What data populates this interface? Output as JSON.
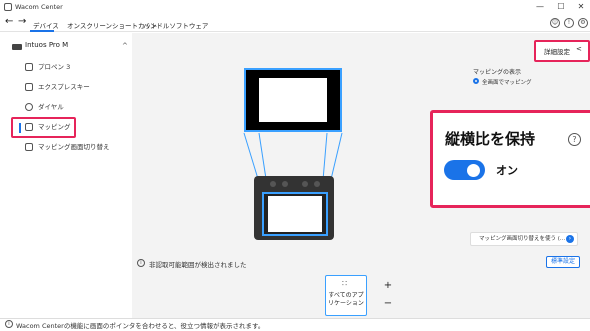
{
  "window": {
    "title": "Wacom Center",
    "minimize": "—",
    "maximize": "☐",
    "close": "✕"
  },
  "nav": {
    "back": "←",
    "forward": "→",
    "tabs": [
      "デバイス",
      "オンスクリーンショートカット",
      "バンドルソフトウェア"
    ]
  },
  "sidebar": {
    "device_name": "Intuos Pro M",
    "items": [
      "プロペン 3",
      "エクスプレスキー",
      "ダイヤル",
      "マッピング",
      "マッピング画面切り替え"
    ],
    "selected": "マッピング"
  },
  "main": {
    "detail_settings": "詳細設定",
    "mapping_display_label": "マッピングの表示",
    "mapping_option": "全画面でマッピング",
    "aspect_title": "縦横比を保持",
    "toggle_label": "オン",
    "toggle_on": true,
    "switch_mapping_button": "マッピング画面切り替えを使う (...",
    "info_text": "非認取可能範囲が検出されました",
    "default_button": "標準設定"
  },
  "dock": {
    "all_apps_label": "すべてのアプリケーション",
    "plus": "+",
    "minus": "−"
  },
  "status": {
    "text": "Wacom Centerの機能に画面のポインタを合わせると、役立つ情報が表示されます。"
  },
  "colors": {
    "accent": "#1a73e8",
    "highlight": "#e6245a"
  }
}
